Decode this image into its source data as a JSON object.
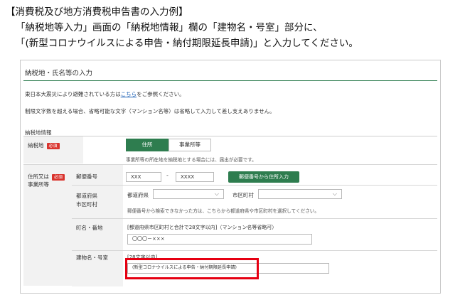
{
  "instructions": {
    "line1": "【消費税及び地方消費税申告書の入力例】",
    "line2": "「納税地等入力」画面の「納税地情報」欄の「建物名・号室」部分に、",
    "line3": "「(新型コロナウイルスによる申告・納付期限延長申請)」と入力してください。"
  },
  "form": {
    "title": "納税地・氏名等の入力",
    "note1_before": "東日本大震災により避難されている方は",
    "note1_link": "こちら",
    "note1_after": "をご参照ください。",
    "note2": "制限文字数を超える場合、省略可能な文字（マンション名等）は省略して入力して差し支えありません。",
    "section_label": "納税地情報",
    "required_badge": "必須",
    "row_nozeichi": {
      "label": "納税地",
      "tab_address": "住所",
      "tab_office": "事業所等",
      "help": "事業所等の所在地を納税地とする場合には、届出が必要です。"
    },
    "row_address": {
      "label_line1": "住所又は",
      "label_line2": "事業所等",
      "postal_label": "郵便番号",
      "postal1": "XXX",
      "postal_sep": "-",
      "postal2": "XXXX",
      "postal_button": "郵便番号から住所入力",
      "pref_label_line1": "都道府県",
      "pref_label_line2": "市区町村",
      "pref_select_label": "都道府県",
      "city_select_label": "市区町村",
      "pref_help": "郵便番号から検索できなかった方は、こちらから都道府県や市区町村を選択してください。",
      "town_label": "町名・番地",
      "town_hint": "[都道府県市区町村と合計で28文字以内]（マンション名等省略可）",
      "town_value": "〇〇〇－×××",
      "building_label": "建物名・号室",
      "building_hint": "[28文字以内]",
      "building_value": "(新型コロナウイルスによる申告・納付期限延長申請)"
    }
  },
  "colors": {
    "accent_green": "#2e7d4f",
    "required_red": "#d9332d",
    "highlight_red": "#e60012"
  }
}
